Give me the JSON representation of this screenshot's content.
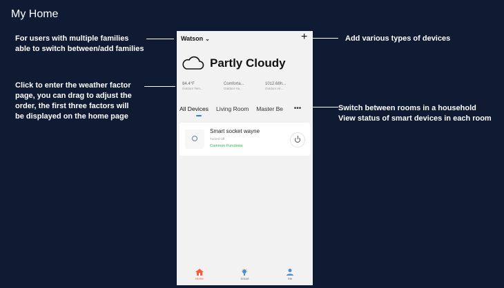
{
  "page_title": "My Home",
  "notes": {
    "families": [
      "For users with multiple families",
      "able to switch between/add families"
    ],
    "weather": [
      "Click to enter the weather factor",
      "page, you can drag to adjust the",
      "order, the first three factors will",
      "be displayed on the home page"
    ],
    "devices": [
      "Add various types of devices"
    ],
    "rooms": [
      "Switch between rooms in a household",
      "View status of smart devices in each room"
    ]
  },
  "phone": {
    "family_name": "Watson",
    "family_chevron": "⌄",
    "add_icon": "+",
    "weather": {
      "icon": "cloud-icon",
      "title": "Partly Cloudy",
      "factors": [
        {
          "value": "84.4°F",
          "label": "Outdoor Tem..."
        },
        {
          "value": "Comforta...",
          "label": "Outdoor Hu..."
        },
        {
          "value": "1012.68h...",
          "label": "Outdoor Air..."
        }
      ]
    },
    "tabs": [
      "All Devices",
      "Living Room",
      "Master Be  "
    ],
    "more_icon": "•••",
    "device": {
      "name": "Smart socket wayne",
      "status": "Turned Off",
      "functions": "Common Functions"
    },
    "nav": [
      {
        "label": "Home",
        "icon": "home-icon"
      },
      {
        "label": "Smart",
        "icon": "bulb-icon"
      },
      {
        "label": "Me",
        "icon": "person-icon"
      }
    ]
  },
  "colors": {
    "background": "#0f1a33",
    "accent": "#1a7cff",
    "home_active": "#ff5a3c",
    "functions_green": "#2ab34a"
  }
}
